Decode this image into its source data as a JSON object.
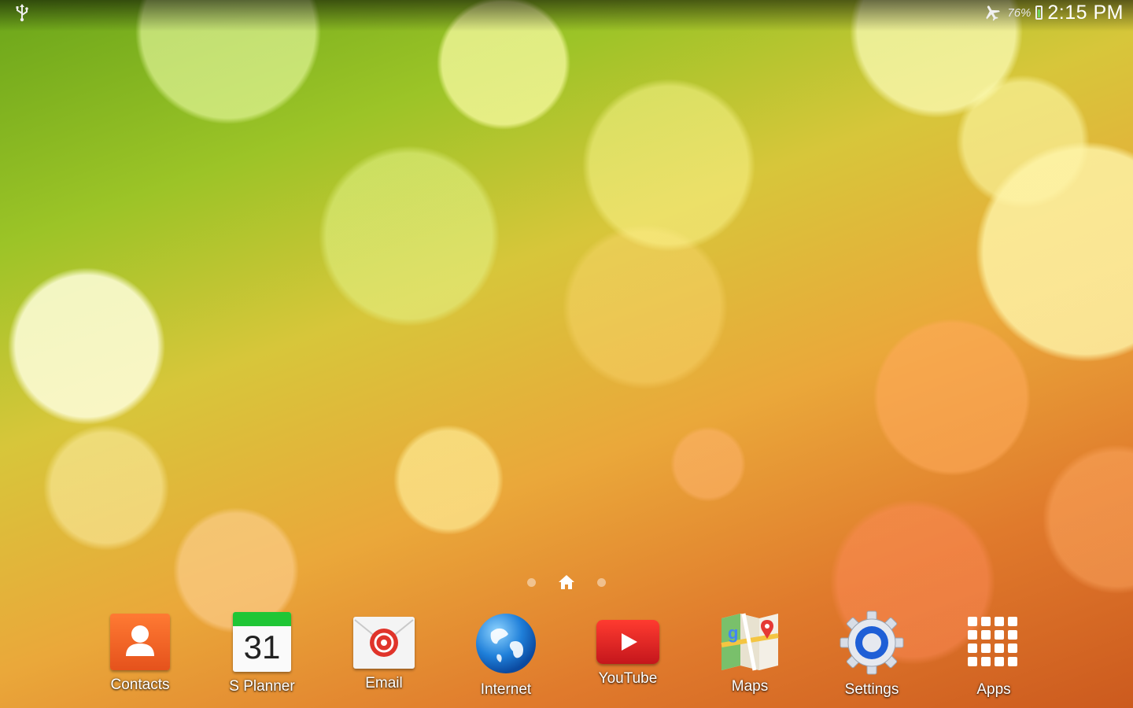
{
  "status_bar": {
    "battery_percent": "76%",
    "time": "2:15 PM",
    "icons": [
      "usb-icon",
      "airplane-mode-icon",
      "battery-icon"
    ],
    "battery_level": 0.76
  },
  "page_indicator": {
    "pages": 3,
    "current": 1,
    "home_icon": "home-icon"
  },
  "dock": {
    "apps": [
      {
        "label": "Contacts",
        "icon": "contacts-icon"
      },
      {
        "label": "S Planner",
        "icon": "calendar-icon",
        "icon_text": "31"
      },
      {
        "label": "Email",
        "icon": "email-icon"
      },
      {
        "label": "Internet",
        "icon": "globe-icon"
      },
      {
        "label": "YouTube",
        "icon": "youtube-icon"
      },
      {
        "label": "Maps",
        "icon": "maps-icon"
      },
      {
        "label": "Settings",
        "icon": "gear-icon"
      },
      {
        "label": "Apps",
        "icon": "app-grid-icon"
      }
    ]
  },
  "colors": {
    "accent_green": "#1fc635",
    "youtube_red": "#e52d27",
    "contacts_orange": "#f26522"
  }
}
